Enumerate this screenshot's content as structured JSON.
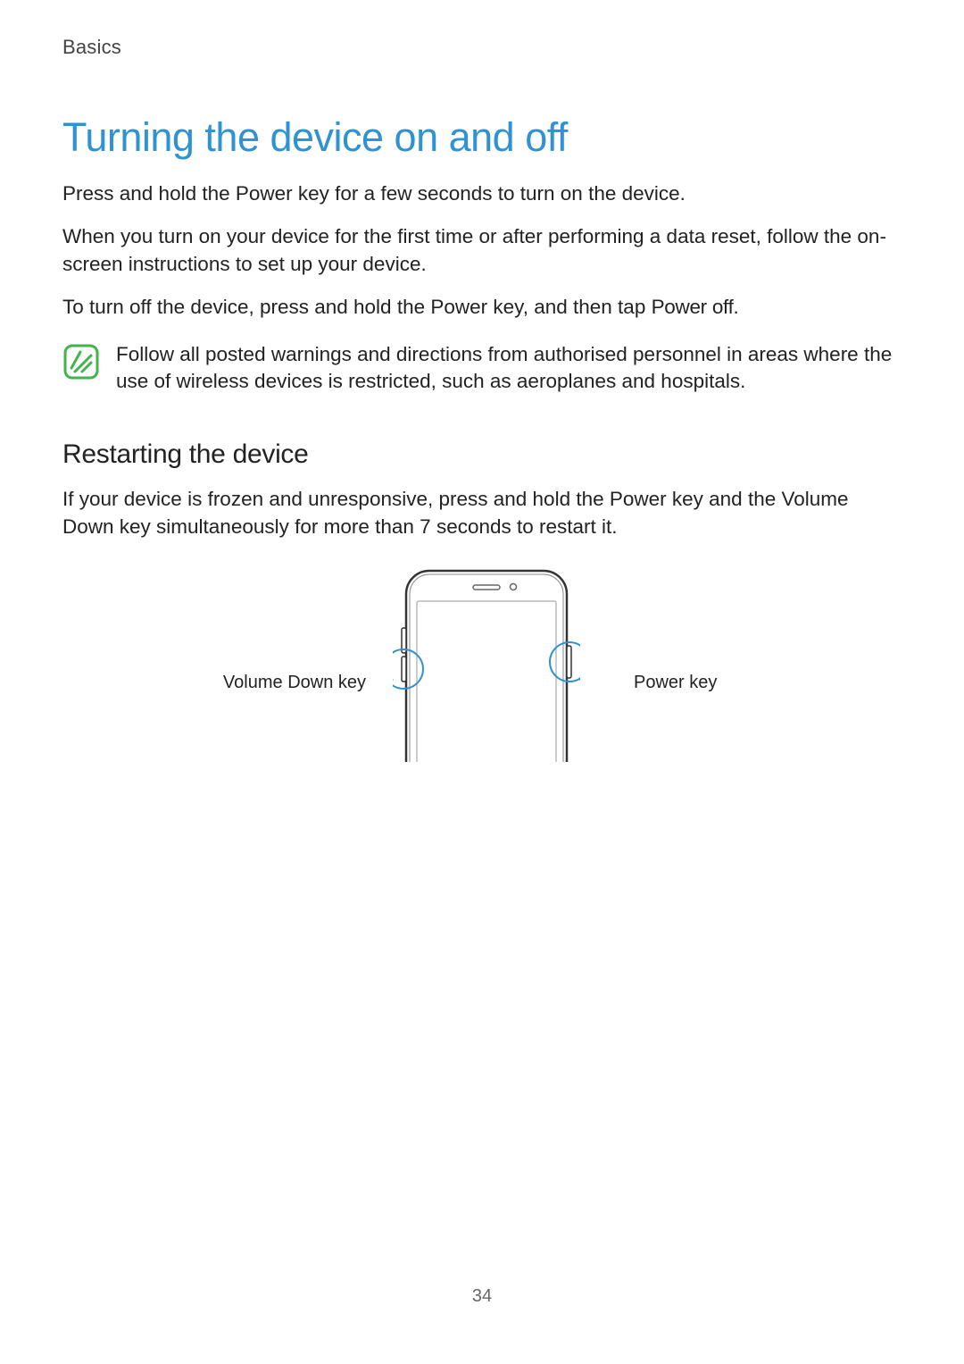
{
  "header": {
    "section": "Basics"
  },
  "title": "Turning the device on and off",
  "paragraphs": {
    "p1": "Press and hold the Power key for a few seconds to turn on the device.",
    "p2": "When you turn on your device for the first time or after performing a data reset, follow the on-screen instructions to set up your device.",
    "p3_prefix": "To turn off the device, press and hold the Power key, and then tap ",
    "p3_action": "Power off",
    "p3_suffix": "."
  },
  "note": {
    "icon_name": "note-icon",
    "text": "Follow all posted warnings and directions from authorised personnel in areas where the use of wireless devices is restricted, such as aeroplanes and hospitals."
  },
  "subheading": "Restarting the device",
  "restart_para": "If your device is frozen and unresponsive, press and hold the Power key and the Volume Down key simultaneously for more than 7 seconds to restart it.",
  "figure": {
    "left_label": "Volume Down key",
    "right_label": "Power key"
  },
  "page_number": "34"
}
